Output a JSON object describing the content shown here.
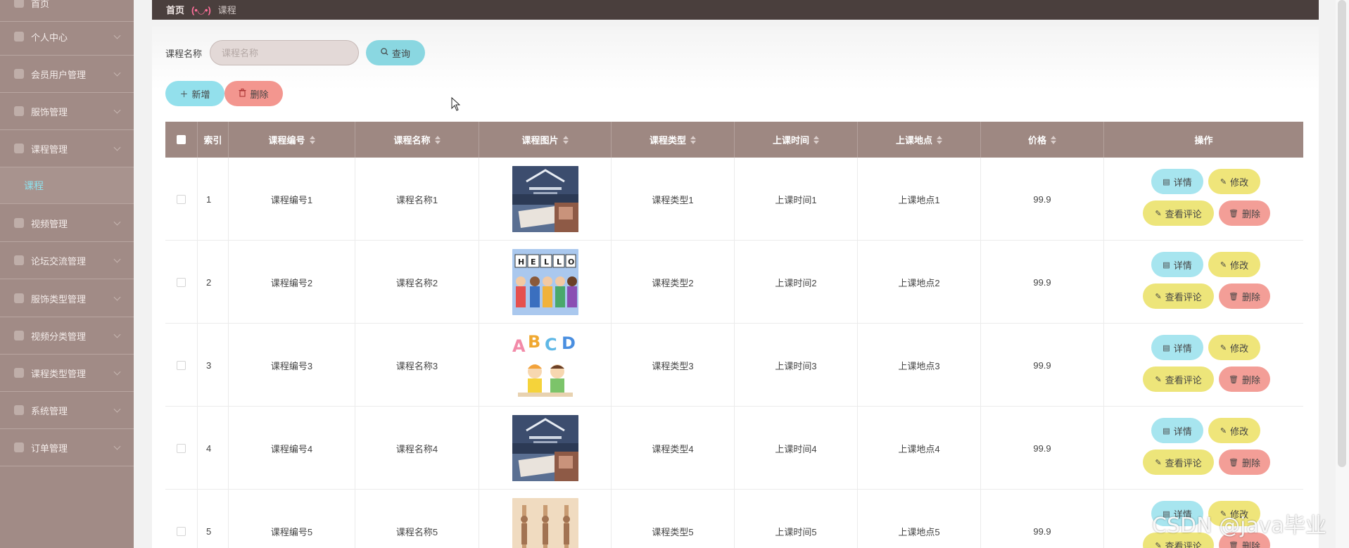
{
  "sidebar": {
    "items": [
      {
        "label": "首页",
        "icon": "home-icon"
      },
      {
        "label": "个人中心",
        "icon": "user-icon"
      },
      {
        "label": "会员用户管理",
        "icon": "users-icon"
      },
      {
        "label": "服饰管理",
        "icon": "shirt-icon"
      },
      {
        "label": "课程管理",
        "icon": "book-icon"
      },
      {
        "label": "视频管理",
        "icon": "video-icon"
      },
      {
        "label": "论坛交流管理",
        "icon": "chat-icon"
      },
      {
        "label": "服饰类型管理",
        "icon": "tag-icon"
      },
      {
        "label": "视频分类管理",
        "icon": "folder-icon"
      },
      {
        "label": "课程类型管理",
        "icon": "list-icon"
      },
      {
        "label": "系统管理",
        "icon": "gear-icon"
      },
      {
        "label": "订单管理",
        "icon": "order-icon"
      }
    ],
    "active_sub": "课程"
  },
  "breadcrumb": {
    "home": "首页",
    "current": "课程",
    "decoration": "(•◡•)"
  },
  "search": {
    "label": "课程名称",
    "placeholder": "课程名称",
    "button": "查询"
  },
  "toolbar": {
    "add": "新增",
    "delete": "删除"
  },
  "table": {
    "headers": {
      "index": "索引",
      "code": "课程编号",
      "name": "课程名称",
      "image": "课程图片",
      "type": "课程类型",
      "time": "上课时间",
      "place": "上课地点",
      "price": "价格",
      "ops": "操作"
    },
    "rows": [
      {
        "index": "1",
        "code": "课程编号1",
        "name": "课程名称1",
        "type": "课程类型1",
        "time": "上课时间1",
        "place": "上课地点1",
        "price": "99.9",
        "image": "classroom-photo"
      },
      {
        "index": "2",
        "code": "课程编号2",
        "name": "课程名称2",
        "type": "课程类型2",
        "time": "上课时间2",
        "place": "上课地点2",
        "price": "99.9",
        "image": "hello-kids-illustration"
      },
      {
        "index": "3",
        "code": "课程编号3",
        "name": "课程名称3",
        "type": "课程类型3",
        "time": "上课时间3",
        "place": "上课地点3",
        "price": "99.9",
        "image": "abcd-kids-illustration"
      },
      {
        "index": "4",
        "code": "课程编号4",
        "name": "课程名称4",
        "type": "课程类型4",
        "time": "上课时间4",
        "place": "上课地点4",
        "price": "99.9",
        "image": "classroom-photo"
      },
      {
        "index": "5",
        "code": "课程编号5",
        "name": "课程名称5",
        "type": "课程类型5",
        "time": "上课时间5",
        "place": "上课地点5",
        "price": "99.9",
        "image": "dance-photo"
      }
    ],
    "actions": {
      "detail": "详情",
      "edit": "修改",
      "comment": "查看评论",
      "delete": "删除"
    }
  },
  "watermark": "CSDN @java毕业",
  "colors": {
    "sidebar": "#a18b86",
    "header": "#4a3f3d",
    "table_header": "#9e8882",
    "cyan": "#8ad7e1",
    "yellow": "#efe57a",
    "red": "#f3968f"
  }
}
